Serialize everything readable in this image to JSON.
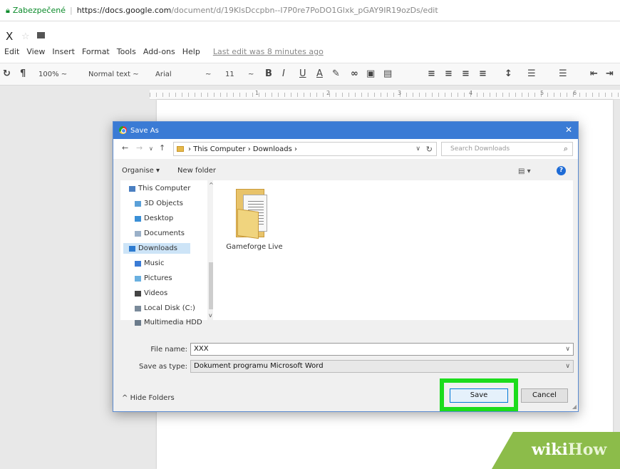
{
  "browser": {
    "secure_label": "Zabezpečené",
    "url_host": "https://docs.google.com",
    "url_path": "/document/d/19KlsDccpbn--I7P0re7PoDO1Glxk_pGAY9IR19ozDs/edit"
  },
  "docs": {
    "title": "X",
    "menus": [
      "Edit",
      "View",
      "Insert",
      "Format",
      "Tools",
      "Add-ons",
      "Help"
    ],
    "last_edit": "Last edit was 8 minutes ago",
    "toolbar": {
      "zoom": "100% ~",
      "style": "Normal text ~",
      "font": "Arial",
      "font_dd": "~",
      "size": "11",
      "size_dd": "~"
    },
    "ruler_numbers": [
      "1",
      "2",
      "3",
      "4",
      "5",
      "6"
    ]
  },
  "dialog": {
    "title": "Save As",
    "close": "✕",
    "breadcrumb": [
      "This Computer",
      "Downloads"
    ],
    "search_placeholder": "Search Downloads",
    "organise": "Organise ▾",
    "new_folder": "New folder",
    "help": "?",
    "nav_items": [
      {
        "label": "This Computer",
        "color": "#4a7fc1"
      },
      {
        "label": "3D Objects",
        "color": "#5aa0d8"
      },
      {
        "label": "Desktop",
        "color": "#3a8fd6"
      },
      {
        "label": "Documents",
        "color": "#9ab0c8"
      },
      {
        "label": "Downloads",
        "color": "#2d7bd0"
      },
      {
        "label": "Music",
        "color": "#3a7bd5"
      },
      {
        "label": "Pictures",
        "color": "#6ab0e0"
      },
      {
        "label": "Videos",
        "color": "#444444"
      },
      {
        "label": "Local Disk (C:)",
        "color": "#7a8a9a"
      },
      {
        "label": "Multimedia HDD",
        "color": "#6a7a8a"
      }
    ],
    "selected_nav": "Downloads",
    "file_name_label": "File name:",
    "file_name_value": "XXX",
    "save_type_label": "Save as type:",
    "save_type_value": "Dokument programu Microsoft Word",
    "hide_folders": "Hide Folders",
    "save": "Save",
    "cancel": "Cancel",
    "files": [
      {
        "name": "Gameforge Live"
      }
    ]
  },
  "watermark": {
    "part1": "wiki",
    "part2": "How"
  },
  "colors": {
    "accent": "#3a7bd5",
    "highlight": "#1cdc1c",
    "watermark": "#8cbc4a"
  }
}
